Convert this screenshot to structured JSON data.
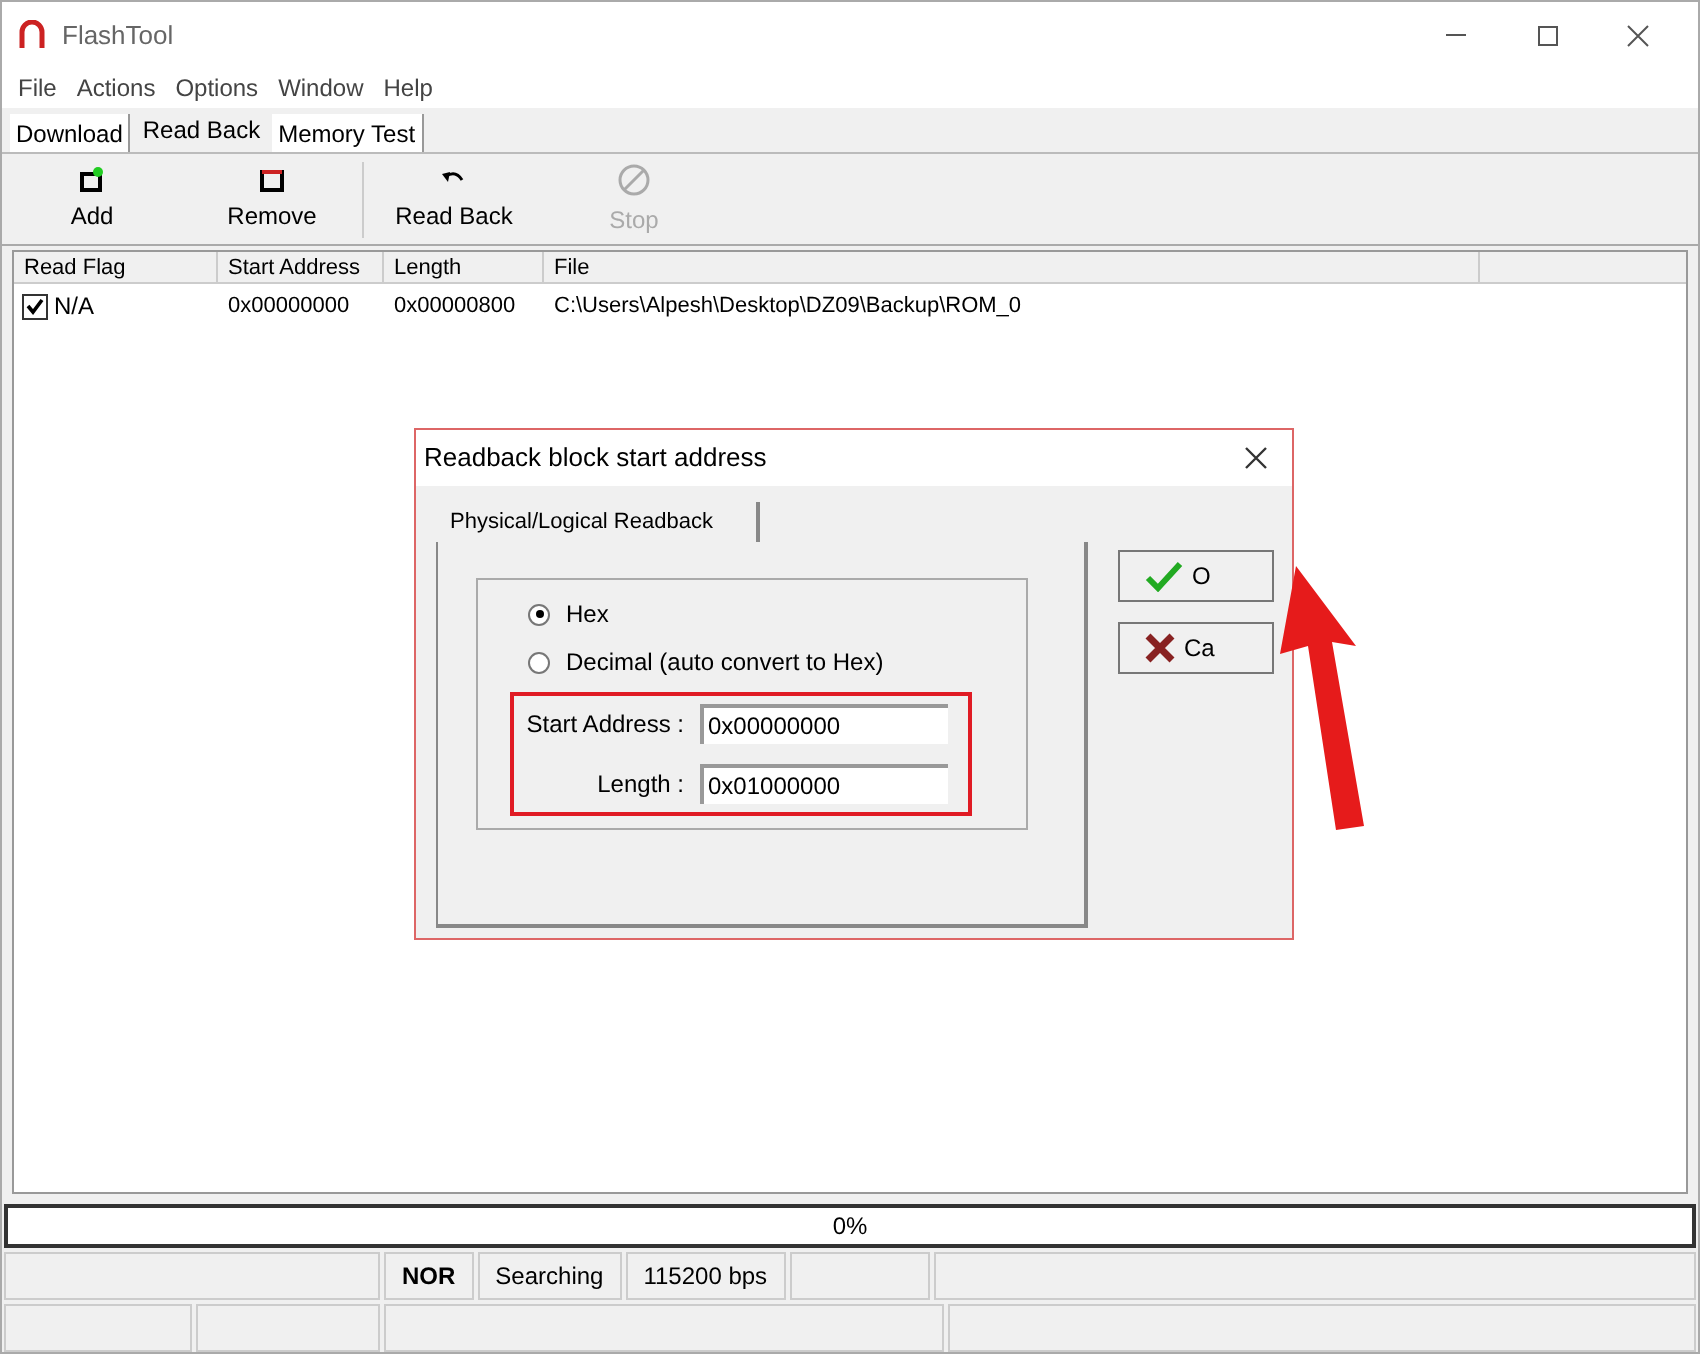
{
  "window": {
    "title": "FlashTool"
  },
  "menu": [
    "File",
    "Actions",
    "Options",
    "Window",
    "Help"
  ],
  "tabs": [
    {
      "label": "Download",
      "selected": false
    },
    {
      "label": "Read Back",
      "selected": true
    },
    {
      "label": "Memory Test",
      "selected": false
    }
  ],
  "toolbar": [
    {
      "label": "Add",
      "kind": "add",
      "disabled": false
    },
    {
      "label": "Remove",
      "kind": "remove",
      "disabled": false
    },
    {
      "label": "Read Back",
      "kind": "readback",
      "disabled": false
    },
    {
      "label": "Stop",
      "kind": "stop",
      "disabled": true
    }
  ],
  "table": {
    "columns": [
      "Read Flag",
      "Start Address",
      "Length",
      "File"
    ],
    "rows": [
      {
        "checked": true,
        "cells": [
          "N/A",
          "0x00000000",
          "0x00000800",
          "C:\\Users\\Alpesh\\Desktop\\DZ09\\Backup\\ROM_0"
        ]
      }
    ]
  },
  "dialog": {
    "title": "Readback block start address",
    "tab": "Physical/Logical Readback",
    "radios": [
      {
        "label": "Hex",
        "selected": true
      },
      {
        "label": "Decimal (auto convert to Hex)",
        "selected": false
      }
    ],
    "fields": [
      {
        "label": "Start Address :",
        "value": "0x00000000"
      },
      {
        "label": "Length :",
        "value": "0x01000000"
      }
    ],
    "buttons": [
      {
        "label": "O",
        "kind": "ok"
      },
      {
        "label": "Ca",
        "kind": "cancel"
      }
    ]
  },
  "progress": {
    "text": "0%",
    "level": 0
  },
  "status_bar": [
    "NOR",
    "Searching",
    "115200 bps"
  ]
}
